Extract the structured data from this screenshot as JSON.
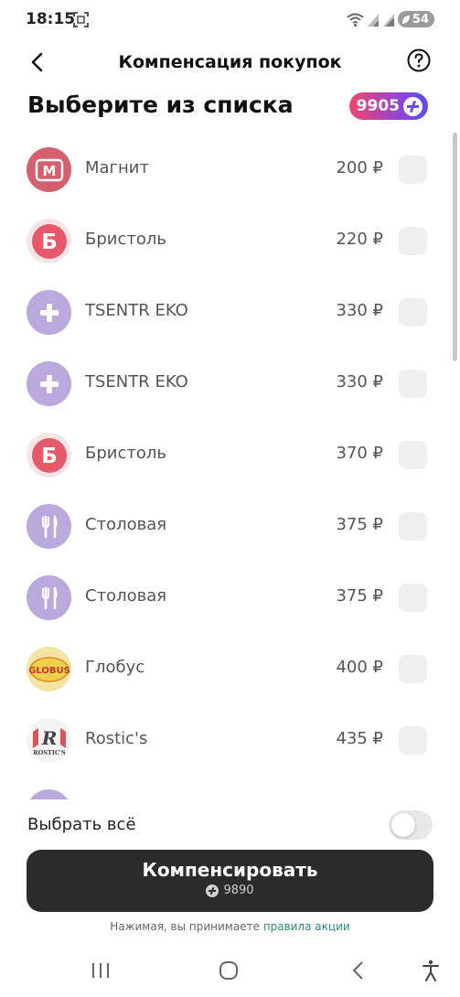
{
  "status_bar": {
    "time": "18:15",
    "battery": "54"
  },
  "header": {
    "title": "Компенсация покупок"
  },
  "section": {
    "title": "Выберите из списка",
    "points": "9905"
  },
  "purchases": [
    {
      "name": "Магнит",
      "price": "200 ₽",
      "logo": "magnit-logo"
    },
    {
      "name": "Бристоль",
      "price": "220 ₽",
      "logo": "bristol-logo"
    },
    {
      "name": "TSENTR EKO",
      "price": "330 ₽",
      "logo": "plus-cross-icon"
    },
    {
      "name": "TSENTR EKO",
      "price": "330 ₽",
      "logo": "plus-cross-icon"
    },
    {
      "name": "Бристоль",
      "price": "370 ₽",
      "logo": "bristol-logo"
    },
    {
      "name": "Столовая",
      "price": "375 ₽",
      "logo": "fork-knife-icon"
    },
    {
      "name": "Столовая",
      "price": "375 ₽",
      "logo": "fork-knife-icon"
    },
    {
      "name": "Глобус",
      "price": "400 ₽",
      "logo": "globus-logo"
    },
    {
      "name": "Rostic's",
      "price": "435 ₽",
      "logo": "rostics-logo"
    }
  ],
  "logo_text": {
    "magnit": "М",
    "bristol": "Б",
    "globus": "GLOBUS",
    "rostics_letter": "R",
    "rostics_banner": "ROSTIC'S"
  },
  "select_all": {
    "label": "Выбрать всё"
  },
  "compensate": {
    "label": "Компенсировать",
    "points": "9890"
  },
  "terms": {
    "prefix": "Нажимая, вы принимаете ",
    "link": "правила акции"
  },
  "colors": {
    "accent_gradient_start": "#f0456b",
    "accent_gradient_end": "#5a4ef0",
    "button_dark": "#2b2b2b",
    "link": "#2a8a7a",
    "magnit": "#d4606e",
    "bristol": "#e5596a",
    "lavender": "#b9a9dc",
    "globus": "#f0cf4a"
  }
}
